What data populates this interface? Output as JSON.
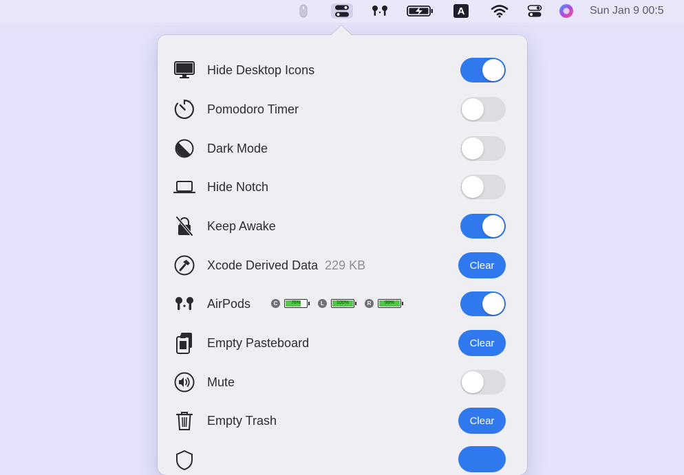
{
  "menubar": {
    "clock": "Sun Jan 9  00:5",
    "input_source_label": "A",
    "icons": [
      "mouse-icon",
      "toggles-icon",
      "airpods-icon",
      "battery-charging-icon",
      "input-source-icon",
      "wifi-icon",
      "control-center-icon",
      "siri-icon"
    ]
  },
  "colors": {
    "accent": "#2f78ed",
    "toggle_off": "#dcdce1",
    "background": "#e3e2fa",
    "popover": "#eeeef3",
    "battery_fill": "#4fc947"
  },
  "items": [
    {
      "label": "Hide Desktop Icons",
      "icon": "desktop-icon",
      "control": "toggle",
      "on": true
    },
    {
      "label": "Pomodoro Timer",
      "icon": "timer-icon",
      "control": "toggle",
      "on": false
    },
    {
      "label": "Dark Mode",
      "icon": "dark-mode-icon",
      "control": "toggle",
      "on": false
    },
    {
      "label": "Hide Notch",
      "icon": "laptop-icon",
      "control": "toggle",
      "on": false
    },
    {
      "label": "Keep Awake",
      "icon": "lock-slash-icon",
      "control": "toggle",
      "on": true
    },
    {
      "label": "Xcode Derived Data",
      "extra": "229 KB",
      "icon": "hammer-icon",
      "control": "button",
      "button_label": "Clear"
    },
    {
      "label": "AirPods",
      "icon": "airpods-icon",
      "control": "toggle",
      "on": true,
      "batteries": [
        {
          "letter": "C",
          "percent": 76,
          "text": "76%"
        },
        {
          "letter": "L",
          "percent": 100,
          "text": "100%"
        },
        {
          "letter": "R",
          "percent": 99,
          "text": "99%"
        }
      ]
    },
    {
      "label": "Empty Pasteboard",
      "icon": "clipboard-icon",
      "control": "button",
      "button_label": "Clear"
    },
    {
      "label": "Mute",
      "icon": "speaker-icon",
      "control": "toggle",
      "on": false
    },
    {
      "label": "Empty Trash",
      "icon": "trash-icon",
      "control": "button",
      "button_label": "Clear"
    }
  ]
}
